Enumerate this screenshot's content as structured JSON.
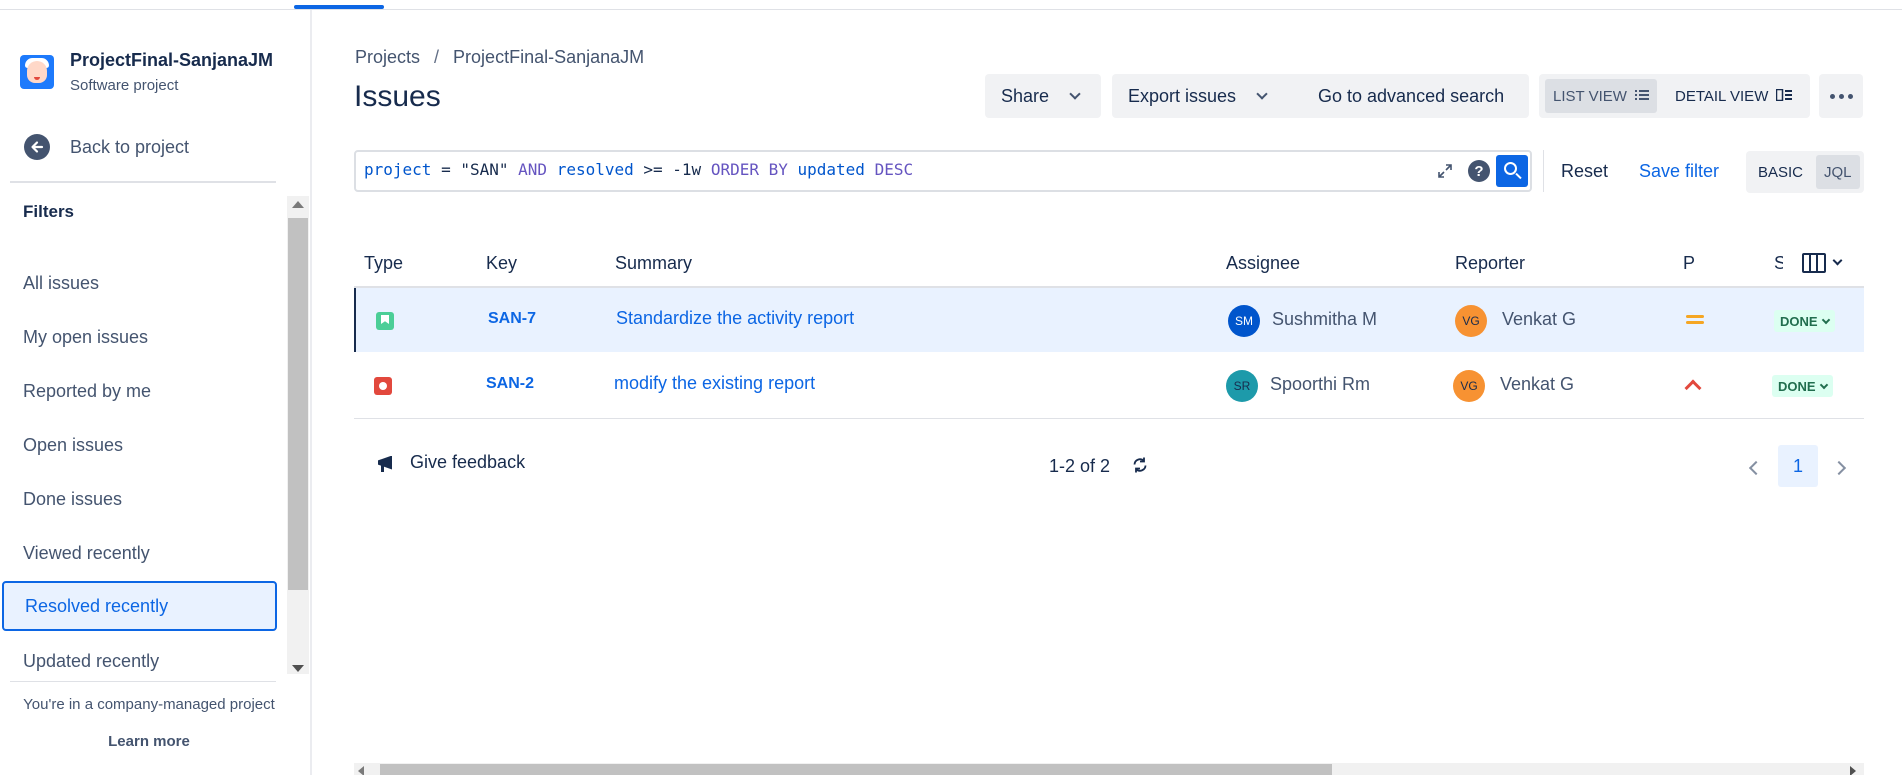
{
  "sidebar": {
    "project_name": "ProjectFinal-SanjanaJM",
    "project_type": "Software project",
    "back_label": "Back to project",
    "filters_heading": "Filters",
    "filters": [
      {
        "label": "All issues"
      },
      {
        "label": "My open issues"
      },
      {
        "label": "Reported by me"
      },
      {
        "label": "Open issues"
      },
      {
        "label": "Done issues"
      },
      {
        "label": "Viewed recently"
      },
      {
        "label": "Resolved recently",
        "active": true
      },
      {
        "label": "Updated recently"
      }
    ],
    "footer_note": "You're in a company-managed project",
    "learn_more": "Learn more"
  },
  "breadcrumbs": {
    "root": "Projects",
    "separator": "/",
    "project": "ProjectFinal-SanjanaJM"
  },
  "page_title": "Issues",
  "toolbar": {
    "share": "Share",
    "export": "Export issues",
    "advanced_search": "Go to advanced search",
    "list_view": "LIST VIEW",
    "detail_view": "DETAIL VIEW"
  },
  "jql": {
    "t1": "project",
    "t2": " = ",
    "t3": "\"SAN\"",
    "t4": " AND ",
    "t5": "resolved",
    "t6": " >= -1w ",
    "t7": "ORDER BY",
    "t8": " updated ",
    "t9": "DESC"
  },
  "search_actions": {
    "help": "?",
    "reset": "Reset",
    "save_filter": "Save filter",
    "basic": "BASIC",
    "jql": "JQL"
  },
  "table": {
    "columns": {
      "type": "Type",
      "key": "Key",
      "summary": "Summary",
      "assignee": "Assignee",
      "reporter": "Reporter",
      "priority": "P",
      "status": "S"
    },
    "rows": [
      {
        "type": "story",
        "key": "SAN-7",
        "summary": "Standardize the activity report",
        "assignee_initials": "SM",
        "assignee": "Sushmitha M",
        "reporter_initials": "VG",
        "reporter": "Venkat G",
        "priority": "medium",
        "status": "DONE"
      },
      {
        "type": "bug",
        "key": "SAN-2",
        "summary": "modify the existing report",
        "assignee_initials": "SR",
        "assignee": "Spoorthi Rm",
        "reporter_initials": "VG",
        "reporter": "Venkat G",
        "priority": "high",
        "status": "DONE"
      }
    ]
  },
  "footer": {
    "feedback": "Give feedback",
    "count": "1-2 of 2",
    "page": "1"
  },
  "colors": {
    "accent": "#0C66E4",
    "avatar_sm": "#0055CC",
    "avatar_sr": "#1D9AAA",
    "avatar_vg": "#F79232",
    "done_bg": "#DCFFF1",
    "done_text": "#216E4E"
  },
  "icons": {
    "back": "arrow-left-icon",
    "list_view": "list-icon",
    "detail_view": "detail-view-icon",
    "more": "more-dots-icon",
    "expand": "expand-icon",
    "search": "search-icon",
    "refresh": "refresh-icon",
    "feedback": "megaphone-icon",
    "columns": "columns-icon"
  }
}
